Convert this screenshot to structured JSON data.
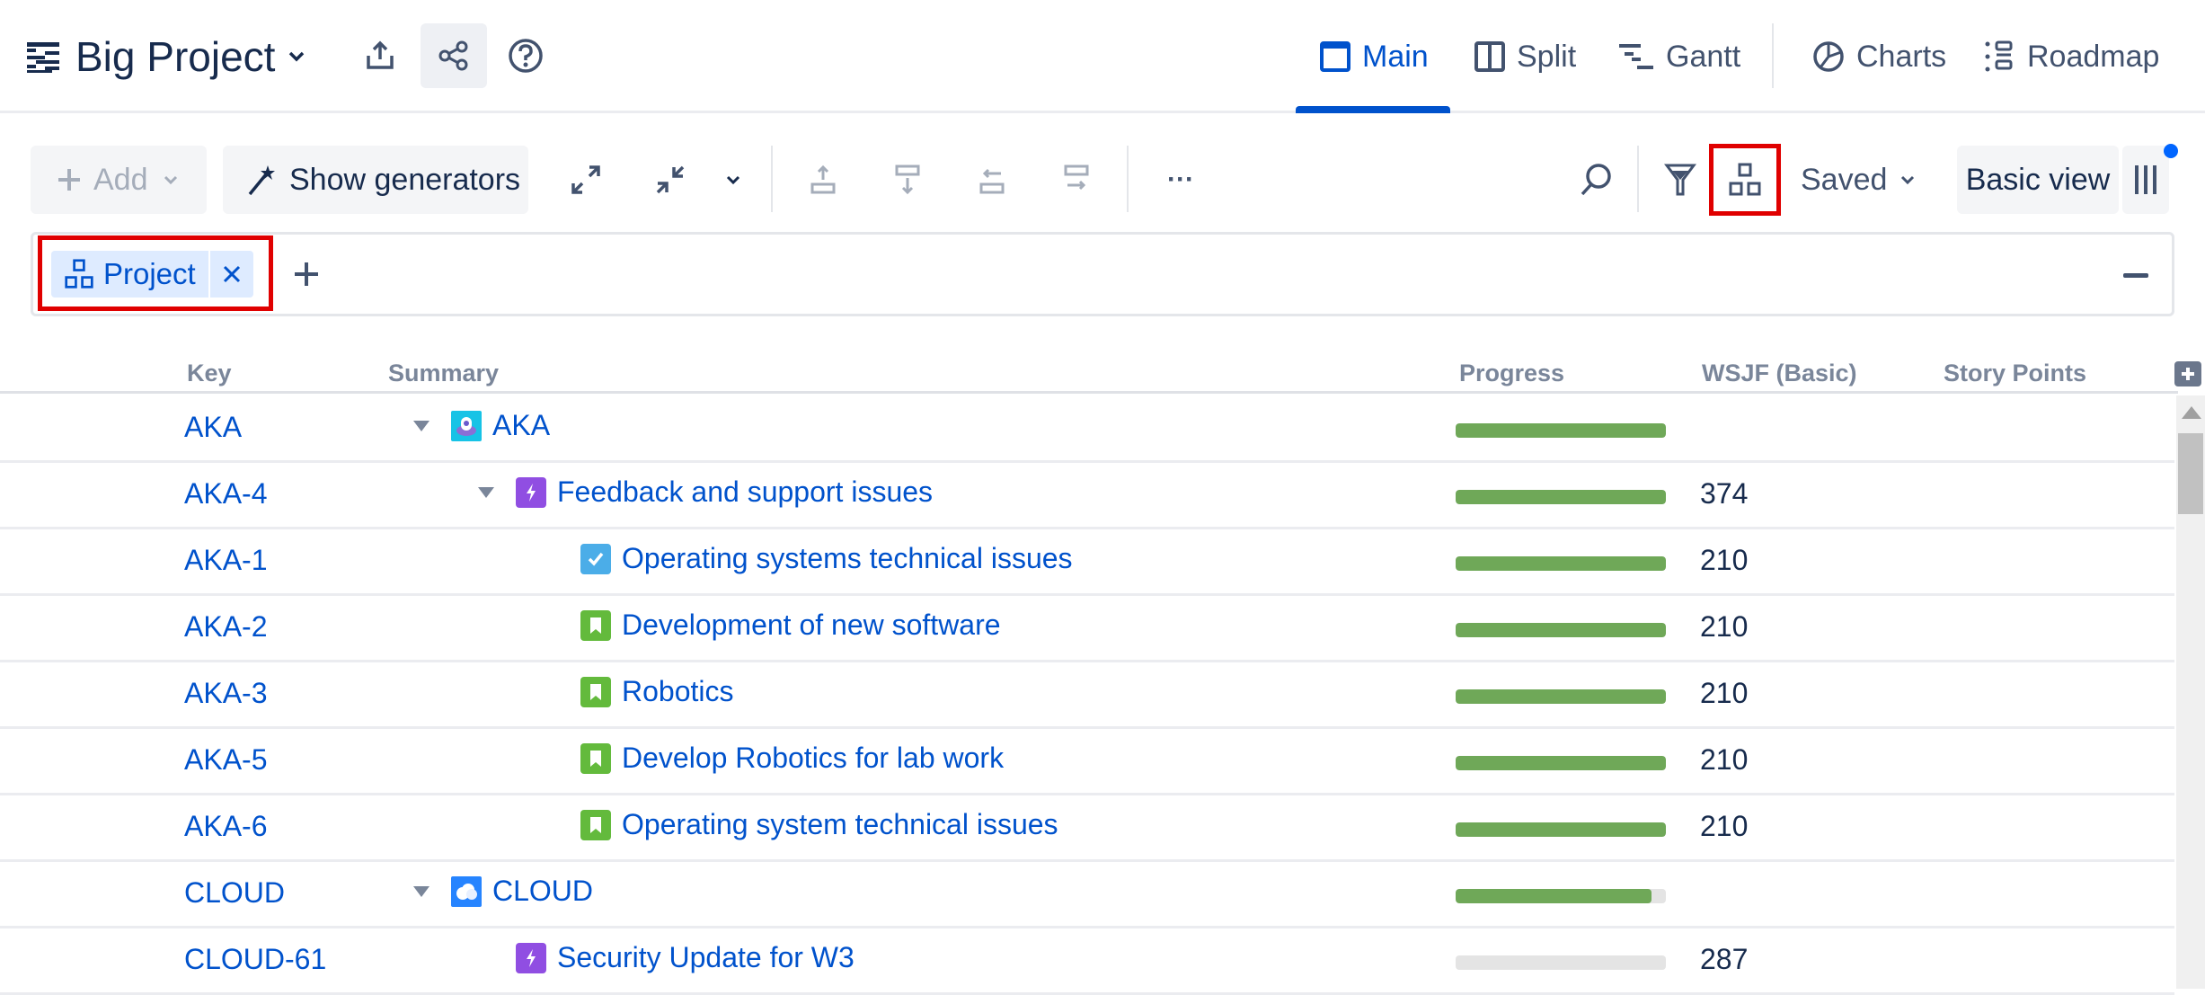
{
  "header": {
    "app_title": "Big Project",
    "nav_tabs": [
      {
        "label": "Main",
        "active": true
      },
      {
        "label": "Split",
        "active": false
      },
      {
        "label": "Gantt",
        "active": false
      },
      {
        "label": "Charts",
        "active": false
      },
      {
        "label": "Roadmap",
        "active": false
      }
    ],
    "icons": [
      "structure-icon",
      "export-icon",
      "share-icon",
      "help-icon"
    ]
  },
  "toolbar": {
    "add_label": "Add",
    "show_generators_label": "Show generators",
    "saved_label": "Saved",
    "basic_view_label": "Basic view",
    "more_label": "···"
  },
  "grouping": {
    "chips": [
      {
        "label": "Project"
      }
    ]
  },
  "table": {
    "columns": [
      "Key",
      "Summary",
      "Progress",
      "WSJF (Basic)",
      "Story Points"
    ],
    "rows": [
      {
        "key": "AKA",
        "summary": "AKA",
        "level": 0,
        "expanded": true,
        "type": "project-aka",
        "progress": 1.0,
        "wsjf": "",
        "story_points": ""
      },
      {
        "key": "AKA-4",
        "summary": "Feedback and support issues",
        "level": 1,
        "expanded": true,
        "type": "epic",
        "progress": 1.0,
        "wsjf": "374",
        "story_points": ""
      },
      {
        "key": "AKA-1",
        "summary": "Operating systems technical issues",
        "level": 2,
        "type": "task",
        "progress": 1.0,
        "wsjf": "210",
        "story_points": ""
      },
      {
        "key": "AKA-2",
        "summary": "Development of new software",
        "level": 2,
        "type": "story",
        "progress": 1.0,
        "wsjf": "210",
        "story_points": ""
      },
      {
        "key": "AKA-3",
        "summary": "Robotics",
        "level": 2,
        "type": "story",
        "progress": 1.0,
        "wsjf": "210",
        "story_points": ""
      },
      {
        "key": "AKA-5",
        "summary": "Develop Robotics for lab work",
        "level": 2,
        "type": "story",
        "progress": 1.0,
        "wsjf": "210",
        "story_points": ""
      },
      {
        "key": "AKA-6",
        "summary": "Operating system technical issues",
        "level": 2,
        "type": "story",
        "progress": 1.0,
        "wsjf": "210",
        "story_points": ""
      },
      {
        "key": "CLOUD",
        "summary": "CLOUD",
        "level": 0,
        "expanded": true,
        "type": "project-cloud",
        "progress": 0.93,
        "wsjf": "",
        "story_points": ""
      },
      {
        "key": "CLOUD-61",
        "summary": "Security Update for W3",
        "level": 1,
        "type": "epic",
        "progress": 0.0,
        "wsjf": "287",
        "story_points": ""
      }
    ]
  },
  "colors": {
    "accent": "#0052CC",
    "progress_fill": "#6fa858",
    "progress_track": "#e4e4e4",
    "epic": "#904ee2",
    "story": "#63ba3c",
    "task": "#4bade8",
    "highlight": "#e00000"
  }
}
